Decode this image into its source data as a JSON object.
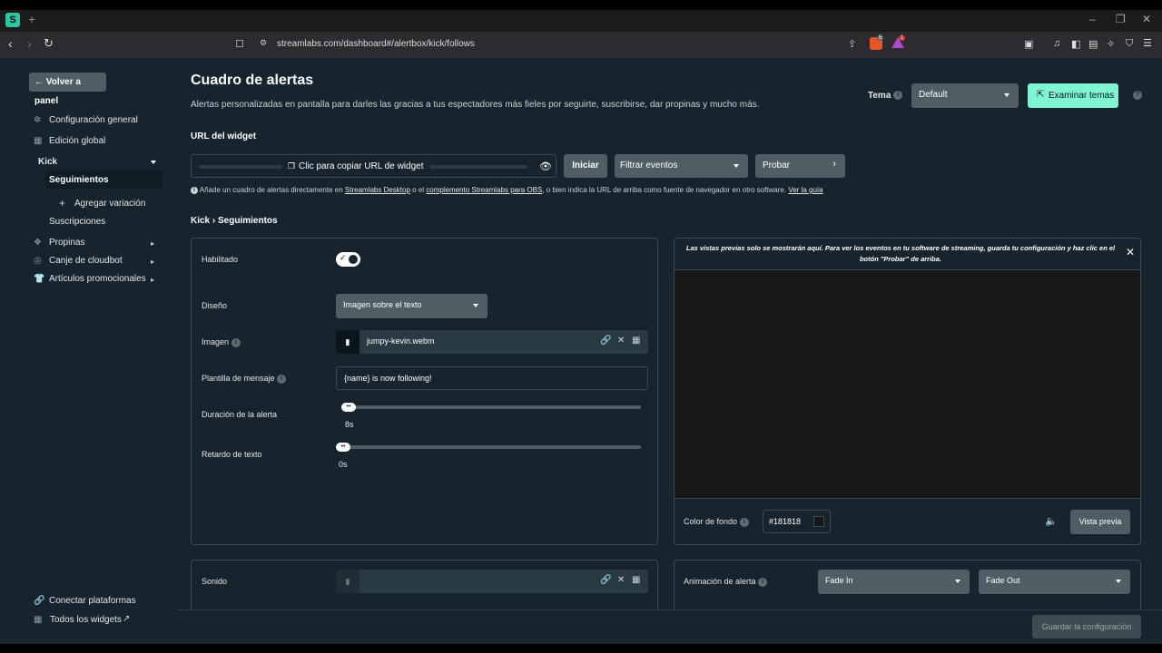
{
  "browser": {
    "favicon_letter": "S",
    "url": "streamlabs.com/dashboard#/alertbox/kick/follows",
    "brave_badge": "5",
    "alert_badge": "1"
  },
  "sidebar": {
    "back_label": "Volver a panel",
    "items": [
      {
        "label": "Configuración general"
      },
      {
        "label": "Edición global"
      },
      {
        "label": "Kick"
      },
      {
        "label": "Seguimientos"
      },
      {
        "label": "Agregar variación"
      },
      {
        "label": "Suscripciones"
      },
      {
        "label": "Propinas"
      },
      {
        "label": "Canje de cloudbot"
      },
      {
        "label": "Artículos promocionales"
      }
    ],
    "bottom": [
      {
        "label": "Conectar plataformas"
      },
      {
        "label": "Todos los widgets"
      }
    ]
  },
  "header": {
    "title": "Cuadro de alertas",
    "description": "Alertas personalizadas en pantalla para darles las gracias a tus espectadores más fieles por seguirte, suscribirse, dar propinas y mucho más.",
    "theme_label": "Tema",
    "theme_value": "Default",
    "browse_themes": "Examinar temas"
  },
  "widget_url": {
    "label": "URL del widget",
    "copy_text": "Clic para copiar URL de widget",
    "start": "Iniciar",
    "filter": "Filtrar eventos",
    "test": "Probar",
    "note_pre": "Añade un cuadro de alertas directamente en ",
    "note_link1": "Streamlabs Desktop",
    "note_mid": " o el ",
    "note_link2": "complemento Streamlabs para OBS",
    "note_post": ", o bien indica la URL de arriba como fuente de navegador en otro software. ",
    "note_link3": "Ver la guía"
  },
  "breadcrumb": "Kick › Seguimientos",
  "settings": {
    "enabled_label": "Habilitado",
    "layout_label": "Diseño",
    "layout_value": "Imagen sobre el texto",
    "image_label": "Imagen",
    "image_file": "jumpy-kevin.webm",
    "template_label": "Plantilla de mensaje",
    "template_value": "{name} is now following!",
    "duration_label": "Duración de la alerta",
    "duration_value": "8s",
    "delay_label": "Retardo de texto",
    "delay_value": "0s",
    "sound_label": "Sonido"
  },
  "preview": {
    "message": "Las vistas previas solo se mostrarán aquí. Para ver los eventos en tu software de streaming, guarda tu configuración y haz clic en el botón \"Probar\" de arriba.",
    "bg_color_label": "Color de fondo",
    "bg_color_value": "#181818",
    "preview_button": "Vista previa",
    "animation_label": "Animación de alerta",
    "anim_in": "Fade In",
    "anim_out": "Fade Out"
  },
  "footer": {
    "save": "Guardar la configuración"
  },
  "colors": {
    "page_bg": "#17242d",
    "accent": "#80f5d2",
    "preview_bg": "#181818"
  }
}
